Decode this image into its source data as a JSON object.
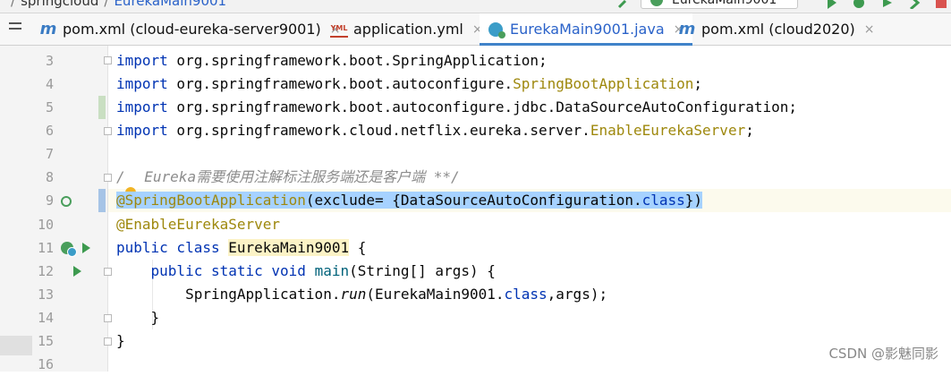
{
  "navbar": {
    "crumb_root": "springcloud",
    "crumb_current": "EurekaMain9001",
    "run_config": "EurekaMain9001"
  },
  "tabs": [
    {
      "label": "pom.xml (cloud-eureka-server9001)",
      "icon": "maven-icon",
      "active": false
    },
    {
      "label": "application.yml",
      "icon": "yml-icon",
      "active": false
    },
    {
      "label": "EurekaMain9001.java",
      "icon": "java-class-icon",
      "active": true
    },
    {
      "label": "pom.xml (cloud2020)",
      "icon": "maven-icon",
      "active": false
    }
  ],
  "close_glyph": "×",
  "editor": {
    "line_numbers": [
      "3",
      "4",
      "5",
      "6",
      "7",
      "8",
      "9",
      "10",
      "11",
      "12",
      "13",
      "14",
      "15",
      "16"
    ],
    "l3": {
      "kw": "import",
      "rest": " org.springframework.boot.SpringApplication;"
    },
    "l4": {
      "kw": "import",
      "pre": " org.springframework.boot.autoconfigure.",
      "ann": "SpringBootApplication",
      "post": ";"
    },
    "l5": {
      "kw": "import",
      "rest": " org.springframework.boot.autoconfigure.jdbc.DataSourceAutoConfiguration;"
    },
    "l6": {
      "kw": "import",
      "pre": " org.springframework.cloud.netflix.eureka.server.",
      "ann": "EnableEurekaServer",
      "post": ";"
    },
    "l8": {
      "open": "/",
      "star": "*",
      "text": " Eureka需要使用注解标注服务端还是客户端 **/"
    },
    "l9": {
      "ann": "@SpringBootApplication",
      "a": "(exclude= {DataSourceAutoConfiguration.",
      "kw": "class",
      "b": "})"
    },
    "l10": {
      "ann": "@EnableEurekaServer"
    },
    "l11": {
      "kw": "public class ",
      "name": "EurekaMain9001",
      "post": " {"
    },
    "l12": {
      "indent": "    ",
      "kw": "public static void ",
      "method": "main",
      "post": "(String[] args) {"
    },
    "l13": {
      "indent": "        ",
      "pre": "SpringApplication.",
      "method": "run",
      "mid": "(EurekaMain9001.",
      "kw": "class",
      "post": ",args);"
    },
    "l14": {
      "text": "    }"
    },
    "l15": {
      "text": "}"
    }
  },
  "watermark": "CSDN @影魅同影",
  "colors": {
    "keyword": "#0033b3",
    "annotation": "#9e880d",
    "selection": "#a6d2ff",
    "active_tab_underline": "#4083c9"
  }
}
